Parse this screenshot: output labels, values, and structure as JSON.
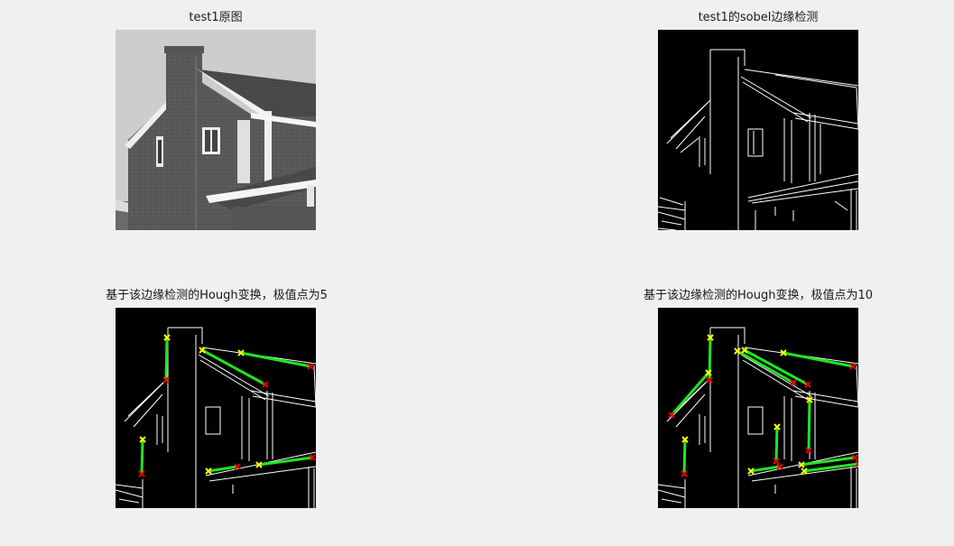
{
  "figure": {
    "panels": [
      {
        "title": "test1原图",
        "kind": "grayscale-photo"
      },
      {
        "title": "test1的sobel边缘检测",
        "kind": "edge-map"
      },
      {
        "title": "基于该边缘检测的Hough变换，极值点为5",
        "kind": "hough-lines",
        "peaks": 5
      },
      {
        "title": "基于该边缘检测的Hough变换，极值点为10",
        "kind": "hough-lines",
        "peaks": 10
      }
    ],
    "colors": {
      "background": "#f0f0f0",
      "edges": "#ffffff",
      "line": "#1ee61e",
      "start_marker": "#ffff00",
      "end_marker": "#e60000"
    }
  }
}
